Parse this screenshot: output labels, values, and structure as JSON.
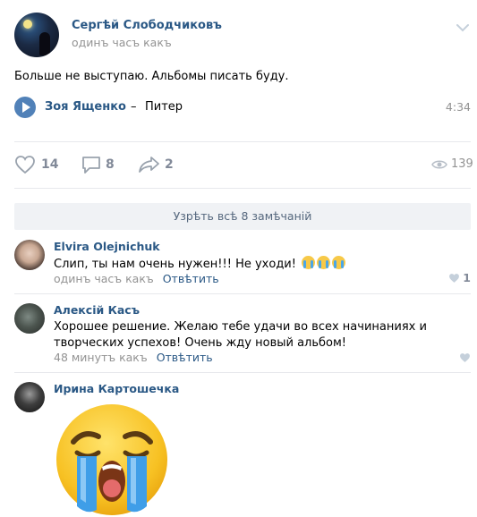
{
  "post": {
    "author": "Сергѣй Слободчиковъ",
    "time": "одинъ часъ какъ",
    "text": "Больше не выступаю. Альбомы писать буду.",
    "audio": {
      "artist": "Зоя Ященко",
      "separator": "–",
      "title": "Питер",
      "duration": "4:34"
    },
    "actions": {
      "likes": "14",
      "comments": "8",
      "shares": "2",
      "views": "139"
    }
  },
  "show_all_comments": "Узрѣть всѣ 8 замѣчаній",
  "comments": [
    {
      "name": "Elvira Olejnichuk",
      "text": "Слип, ты нам очень нужен!!! Не уходи!",
      "time": "одинъ часъ какъ",
      "reply": "Отвѣтить",
      "likes": "1"
    },
    {
      "name": "Алексiй Касъ",
      "text": "Хорошее решение. Желаю тебе удачи во всех начинаниях и творческих успехов! Очень жду новый альбом!",
      "time": "48 минутъ какъ",
      "reply": "Отвѣтить",
      "likes": ""
    },
    {
      "name": "Ирина Картошечка"
    }
  ],
  "colors": {
    "link": "#2a5885",
    "accent": "#5181b8",
    "muted": "#939393",
    "button_bg": "#f0f2f5"
  }
}
